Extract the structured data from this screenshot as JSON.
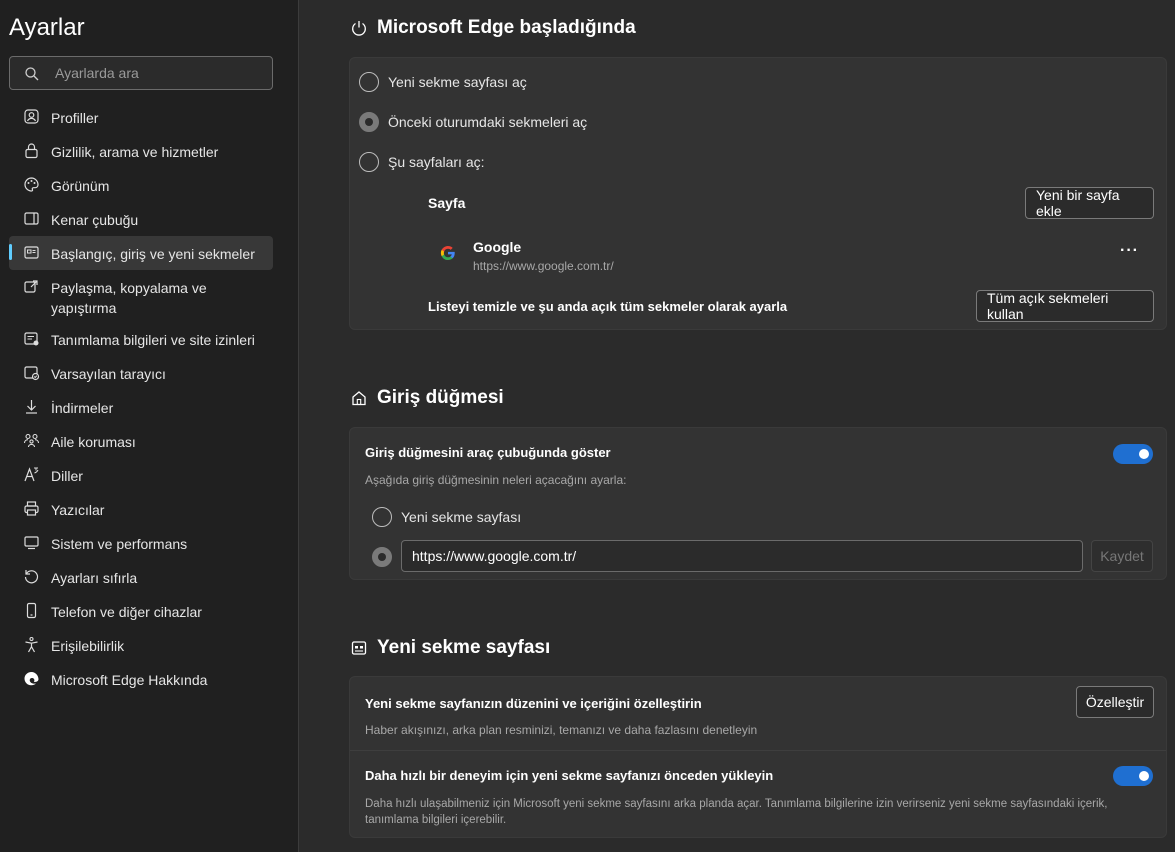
{
  "sidebar": {
    "title": "Ayarlar",
    "search_placeholder": "Ayarlarda ara",
    "items": [
      {
        "label": "Profiller",
        "icon": "profile-icon"
      },
      {
        "label": "Gizlilik, arama ve hizmetler",
        "icon": "lock-icon"
      },
      {
        "label": "Görünüm",
        "icon": "palette-icon"
      },
      {
        "label": "Kenar çubuğu",
        "icon": "sidebar-icon"
      },
      {
        "label": "Başlangıç, giriş ve yeni sekmeler",
        "icon": "power-icon",
        "active": true
      },
      {
        "label": "Paylaşma, kopyalama ve yapıştırma",
        "icon": "share-icon"
      },
      {
        "label": "Tanımlama bilgileri ve site izinleri",
        "icon": "cookie-icon"
      },
      {
        "label": "Varsayılan tarayıcı",
        "icon": "browser-check-icon"
      },
      {
        "label": "İndirmeler",
        "icon": "download-icon"
      },
      {
        "label": "Aile koruması",
        "icon": "family-icon"
      },
      {
        "label": "Diller",
        "icon": "language-icon"
      },
      {
        "label": "Yazıcılar",
        "icon": "printer-icon"
      },
      {
        "label": "Sistem ve performans",
        "icon": "system-icon"
      },
      {
        "label": "Ayarları sıfırla",
        "icon": "reset-icon"
      },
      {
        "label": "Telefon ve diğer cihazlar",
        "icon": "phone-icon"
      },
      {
        "label": "Erişilebilirlik",
        "icon": "accessibility-icon"
      },
      {
        "label": "Microsoft Edge Hakkında",
        "icon": "edge-logo-icon"
      }
    ]
  },
  "startup": {
    "title": "Microsoft Edge başladığında",
    "option_new_tab": "Yeni sekme sayfası aç",
    "option_previous": "Önceki oturumdaki sekmeleri aç",
    "option_pages": "Şu sayfaları aç:",
    "page_header": "Sayfa",
    "add_page_button": "Yeni bir sayfa ekle",
    "page_name": "Google",
    "page_url": "https://www.google.com.tr/",
    "more_button": "···",
    "clear_label": "Listeyi temizle ve şu anda açık tüm sekmeler olarak ayarla",
    "use_all_button": "Tüm açık sekmeleri kullan"
  },
  "home": {
    "title": "Giriş düğmesi",
    "show_label": "Giriş düğmesini araç çubuğunda göster",
    "description": "Aşağıda giriş düğmesinin neleri açacağını ayarla:",
    "option_new_tab": "Yeni sekme sayfası",
    "url_value": "https://www.google.com.tr/",
    "save_button": "Kaydet"
  },
  "newtab": {
    "title": "Yeni sekme sayfası",
    "customize_label": "Yeni sekme sayfanızın düzenini ve içeriğini özelleştirin",
    "customize_desc": "Haber akışınızı, arka plan resminizi, temanızı ve daha fazlasını denetleyin",
    "customize_button": "Özelleştir",
    "preload_label": "Daha hızlı bir deneyim için yeni sekme sayfanızı önceden yükleyin",
    "preload_desc_1": "Daha hızlı ulaşabilmeniz için Microsoft yeni sekme sayfasını arka planda açar. Tanımlama bilgilerine izin verirseniz yeni sekme sayfasındaki içerik,",
    "preload_desc_2": "tanımlama bilgileri içerebilir."
  }
}
